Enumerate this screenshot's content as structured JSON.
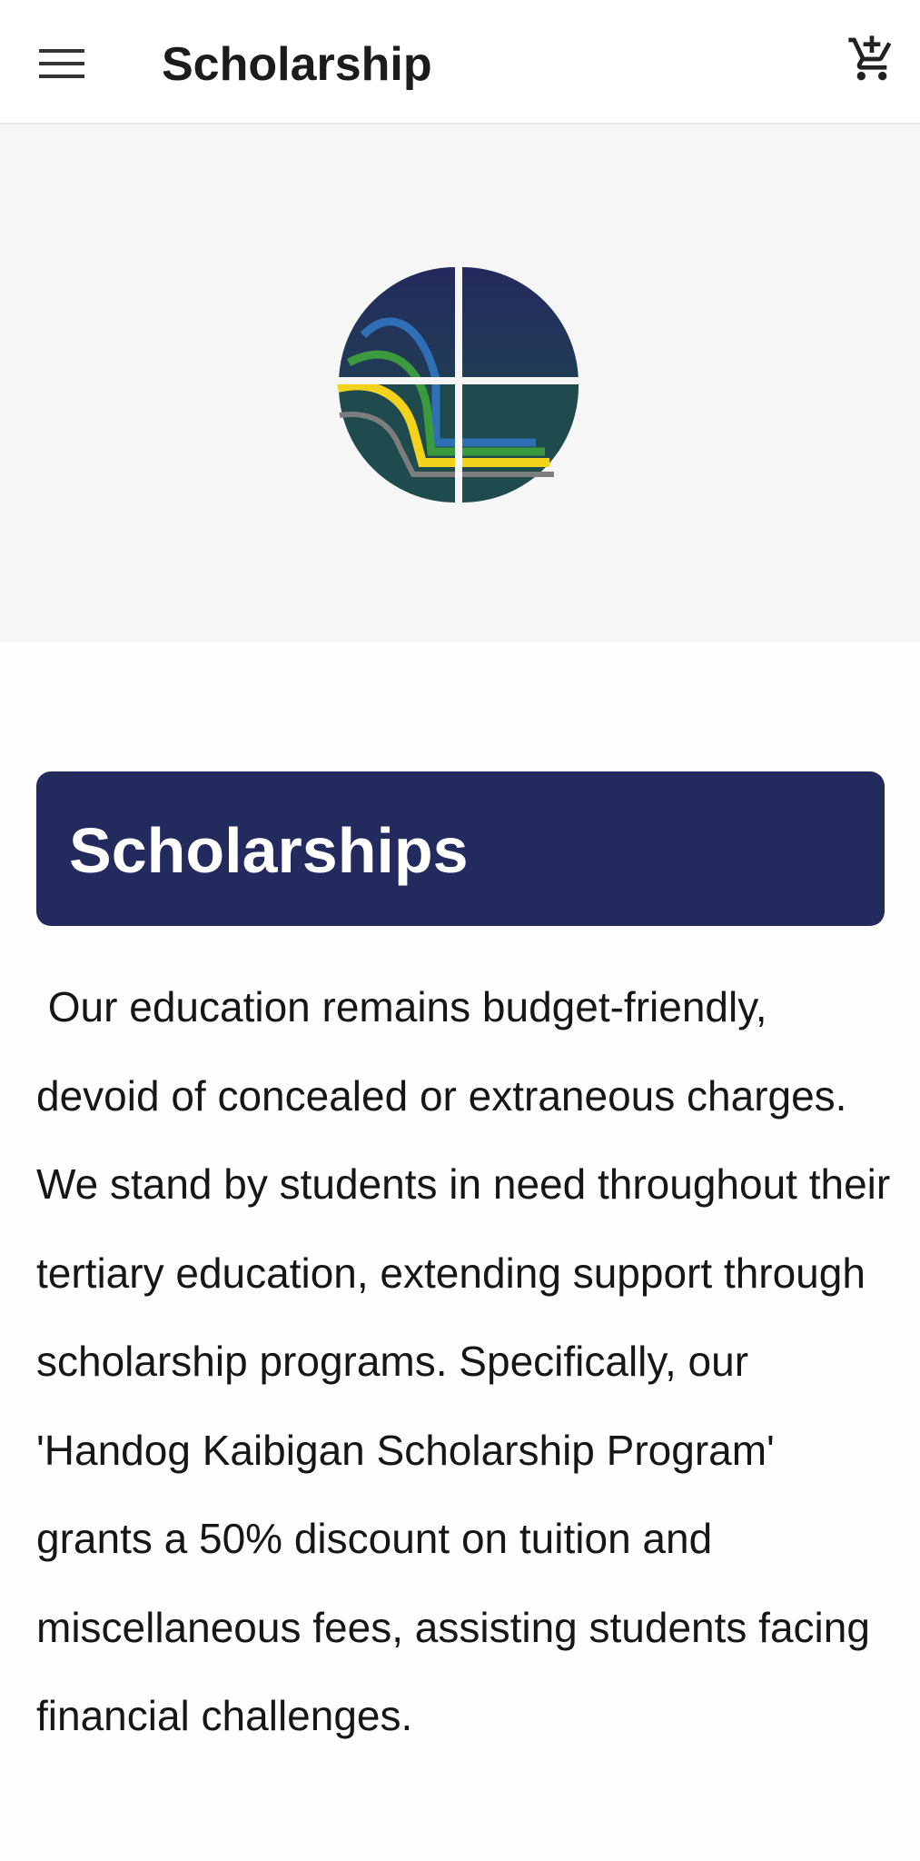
{
  "app_bar": {
    "title": "Scholarship",
    "menu_icon": "menu-icon",
    "cart_icon": "add-shopping-cart-icon"
  },
  "hero": {
    "logo": "institution-logo",
    "colors": {
      "navy": "#232a5e",
      "teal": "#1f4a4e",
      "blue": "#2e6fb5",
      "green": "#3a9a3d",
      "yellow": "#f2d21b",
      "gray": "#7d7d7d"
    }
  },
  "content": {
    "heading": "Scholarships",
    "paragraph": " Our education remains budget-friendly, devoid of concealed or extraneous charges. We stand by students in need throughout their tertiary education, extending support through scholarship programs. Specifically, our 'Handog Kaibigan Scholarship Program' grants a 50% discount on tuition and miscellaneous fees, assisting students facing financial challenges."
  },
  "theme": {
    "header_bg": "#232a5e",
    "hero_bg": "#f6f6f6"
  }
}
